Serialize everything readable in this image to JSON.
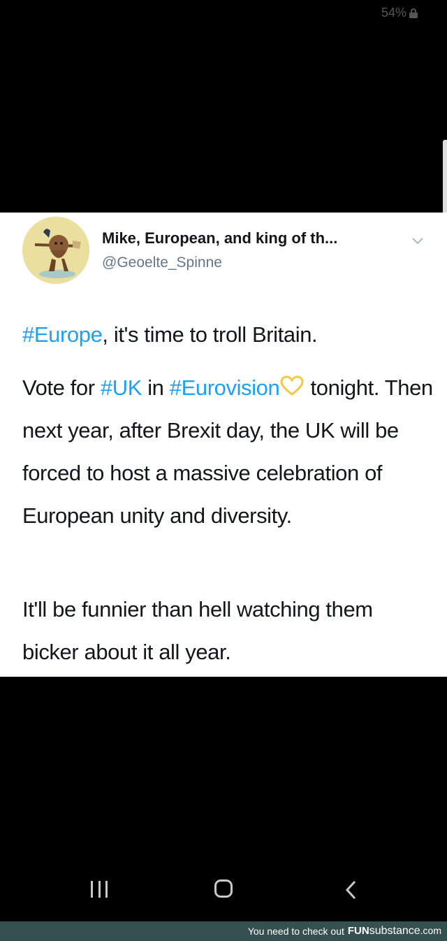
{
  "status": {
    "battery": "54%"
  },
  "tweet": {
    "display_name": "Mike, European, and king of th...",
    "handle": "@Geoelte_Spinne",
    "p1": {
      "tag": "#Europe",
      "text": ", it's time to troll Britain."
    },
    "p2": {
      "pre": "Vote for ",
      "tag1": "#UK",
      "mid": " in ",
      "tag2": "#Eurovision",
      "rest": "tonight. Then next year, after Brexit day, the UK will be forced to host a massive celebration of European unity and diversity."
    },
    "p3": "It'll be funnier than hell watching them bicker about it all year.",
    "heart_color": "#f5c842",
    "hashtag_color": "#1da1f2"
  },
  "footer": {
    "text": "You need to check out",
    "brand_bold": "FUN",
    "brand_rest": "substance",
    "domain": ".com"
  },
  "navbar": {
    "icons": [
      "recent-apps-icon",
      "home-icon",
      "back-icon"
    ]
  }
}
